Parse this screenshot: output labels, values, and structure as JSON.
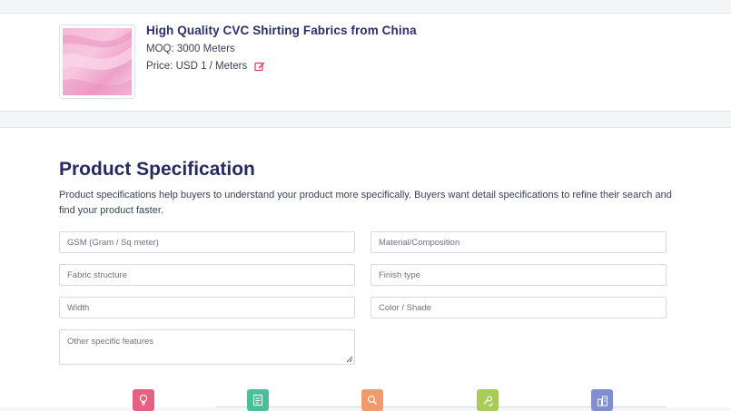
{
  "product": {
    "title": "High Quality CVC Shirting Fabrics from China",
    "moq": "MOQ: 3000 Meters",
    "price": "Price: USD 1 / Meters",
    "image_icon": "pink-fabric-thumbnail",
    "edit_icon": "edit-icon"
  },
  "spec": {
    "title": "Product Specification",
    "description": "Product specifications help buyers to understand your product more specifically. Buyers want detail specifications to refine their search and find your product faster.",
    "fields": {
      "gsm": "GSM (Gram / Sq meter)",
      "material": "Material/Composition",
      "fabric_structure": "Fabric structure",
      "finish_type": "Finish type",
      "width": "Width",
      "color": "Color / Shade",
      "other": "Other specific features"
    }
  },
  "steps": [
    {
      "icon": "lightbulb-icon",
      "color": "#e8607f"
    },
    {
      "icon": "checklist-icon",
      "color": "#4cbf9a"
    },
    {
      "icon": "search-icon",
      "color": "#f29a6c"
    },
    {
      "icon": "settings-check-icon",
      "color": "#a7cc57"
    },
    {
      "icon": "buildings-icon",
      "color": "#7f8fd1"
    }
  ]
}
